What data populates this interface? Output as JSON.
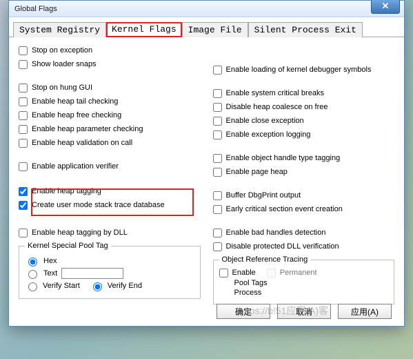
{
  "window": {
    "title": "Global Flags"
  },
  "tabs": [
    {
      "label": "System Registry"
    },
    {
      "label": "Kernel Flags"
    },
    {
      "label": "Image File"
    },
    {
      "label": "Silent Process Exit"
    }
  ],
  "left": {
    "stop_exception": "Stop on exception",
    "show_loader": "Show loader snaps",
    "stop_hung": "Stop on hung GUI",
    "tail_check": "Enable heap tail checking",
    "free_check": "Enable heap free checking",
    "param_check": "Enable heap parameter checking",
    "valid_call": "Enable heap validation on call",
    "app_verifier": "Enable application verifier",
    "heap_tagging": "Enable heap tagging",
    "stack_db": "Create user mode stack trace database",
    "tag_by_dll": "Enable heap tagging by DLL"
  },
  "left_checked": {
    "heap_tagging": true,
    "stack_db": true
  },
  "pool": {
    "legend": "Kernel Special Pool Tag",
    "hex": "Hex",
    "text": "Text",
    "text_value": "",
    "verify_start": "Verify Start",
    "verify_end": "Verify End",
    "selected_mode": "hex",
    "verify_selected": "end"
  },
  "right": {
    "load_sym": "Enable loading of kernel debugger symbols",
    "sys_breaks": "Enable system critical breaks",
    "disable_coalesce": "Disable heap coalesce on free",
    "close_exc": "Enable close exception",
    "exc_logging": "Enable exception logging",
    "obj_tag": "Enable object handle type tagging",
    "page_heap": "Enable page heap",
    "buf_dbgprint": "Buffer DbgPrint output",
    "early_cs": "Early critical section event creation",
    "bad_handles": "Enable bad handles detection",
    "disable_dll": "Disable protected DLL verification"
  },
  "ort": {
    "legend": "Object Reference Tracing",
    "enable": "Enable",
    "permanent": "Permanent",
    "pool_tags": "Pool Tags",
    "process": "Process"
  },
  "buttons": {
    "ok": "确定",
    "cancel": "取消",
    "apply": "应用(A)"
  },
  "watermark": "https://b!51应用(A)客"
}
